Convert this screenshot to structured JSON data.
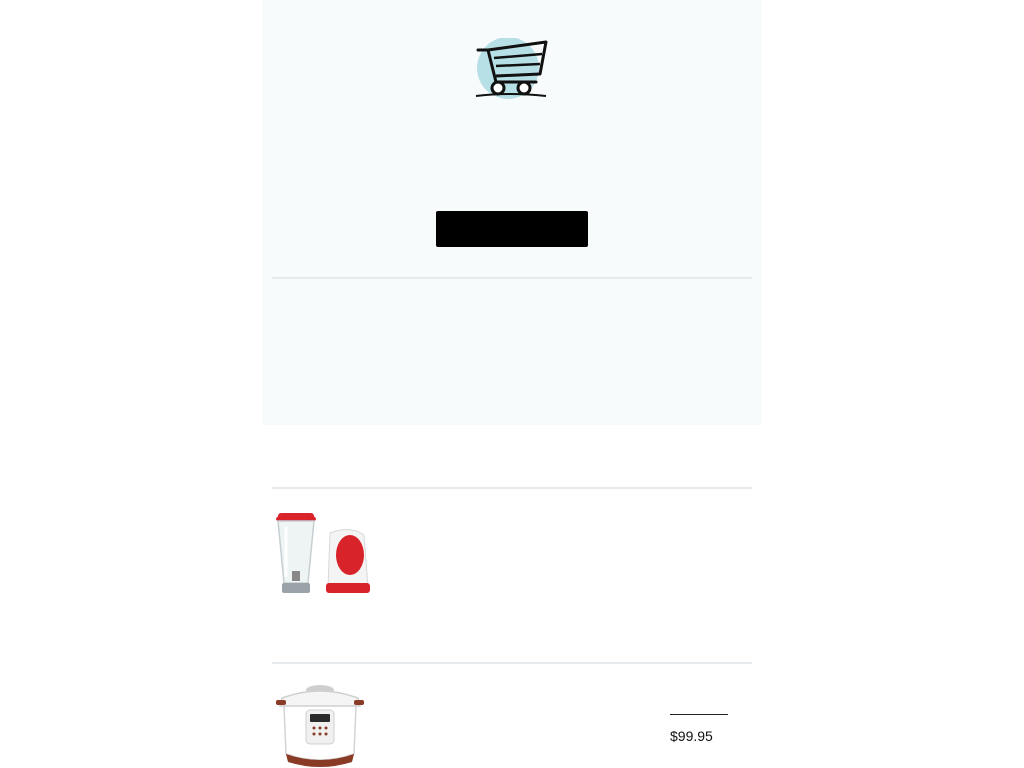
{
  "cart": {
    "icon": "shopping-cart-icon",
    "accent_color": "#b7e0e6",
    "button_label": ""
  },
  "products": [
    {
      "image": "blender-image",
      "price": ""
    },
    {
      "image": "pressure-cooker-image",
      "price": "$99.95"
    }
  ],
  "colors": {
    "panel_bg": "#f7fbfc",
    "button_bg": "#000000",
    "divider": "#e6eaec",
    "appliance_red": "#d8232a",
    "cooker_brown": "#8a3b26"
  }
}
